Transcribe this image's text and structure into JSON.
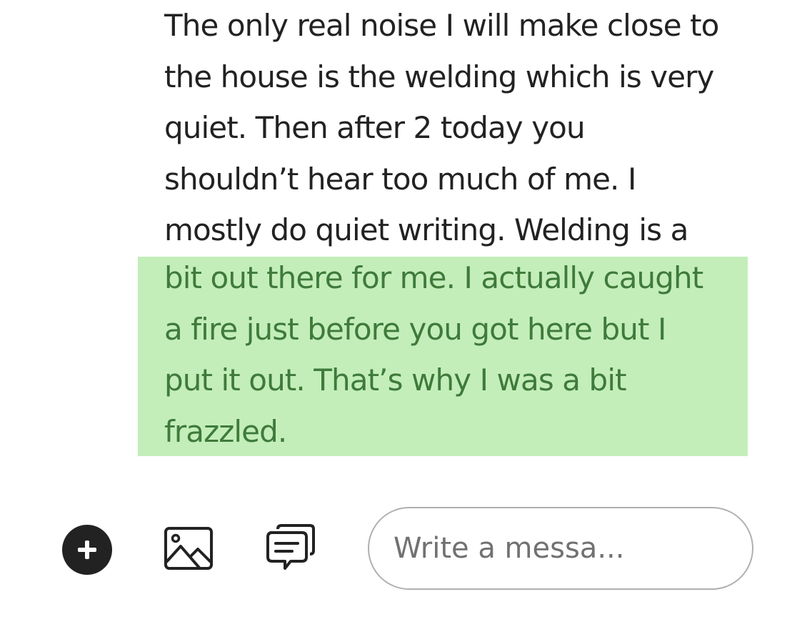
{
  "message": {
    "plain_lines": [
      "The only real noise I will make close to",
      "the house is the welding which is very",
      "quiet. Then  after 2 today you",
      "shouldn’t hear too much of me. I",
      "mostly do quiet writing. Welding is a"
    ],
    "highlighted_lines": [
      "bit out there for me. I actually caught",
      "a fire just before you got here but I",
      "put it out. That’s why I was a bit",
      "frazzled."
    ],
    "highlight_color": "#c3eeba",
    "highlight_text_color": "#3f7a3a",
    "text_color": "#222222"
  },
  "composer": {
    "add_icon": "plus-circle-icon",
    "image_icon": "image-icon",
    "quick_reply_icon": "chat-bubbles-icon",
    "input_placeholder": "Write a messa...",
    "input_value": ""
  }
}
